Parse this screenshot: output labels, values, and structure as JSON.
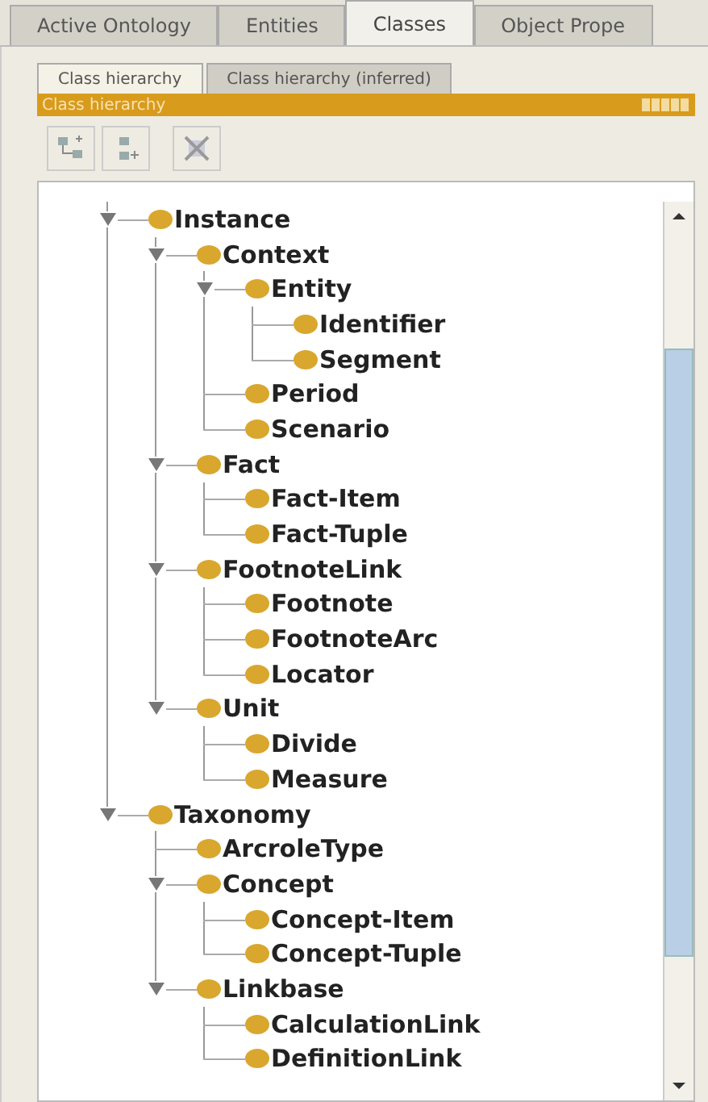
{
  "tabs": [
    {
      "label": "Active Ontology",
      "selected": false
    },
    {
      "label": "Entities",
      "selected": false
    },
    {
      "label": "Classes",
      "selected": true
    },
    {
      "label": "Object Prope",
      "selected": false
    }
  ],
  "subtabs": [
    {
      "label": "Class hierarchy",
      "selected": true
    },
    {
      "label": "Class hierarchy (inferred)",
      "selected": false
    }
  ],
  "panel": {
    "title": "Class hierarchy"
  },
  "toolbar": [
    {
      "kind": "add-subclass"
    },
    {
      "kind": "add-sibling"
    },
    {
      "kind": "delete"
    }
  ],
  "tree": [
    {
      "label": "Instance",
      "expanded": true,
      "children": [
        {
          "label": "Context",
          "expanded": true,
          "children": [
            {
              "label": "Entity",
              "expanded": true,
              "children": [
                {
                  "label": "Identifier"
                },
                {
                  "label": "Segment"
                }
              ]
            },
            {
              "label": "Period"
            },
            {
              "label": "Scenario"
            }
          ]
        },
        {
          "label": "Fact",
          "expanded": true,
          "children": [
            {
              "label": "Fact-Item"
            },
            {
              "label": "Fact-Tuple"
            }
          ]
        },
        {
          "label": "FootnoteLink",
          "expanded": true,
          "children": [
            {
              "label": "Footnote"
            },
            {
              "label": "FootnoteArc"
            },
            {
              "label": "Locator"
            }
          ]
        },
        {
          "label": "Unit",
          "expanded": true,
          "children": [
            {
              "label": "Divide"
            },
            {
              "label": "Measure"
            }
          ]
        }
      ]
    },
    {
      "label": "Taxonomy",
      "expanded": true,
      "children": [
        {
          "label": "ArcroleType"
        },
        {
          "label": "Concept",
          "expanded": true,
          "children": [
            {
              "label": "Concept-Item"
            },
            {
              "label": "Concept-Tuple"
            }
          ]
        },
        {
          "label": "Linkbase",
          "expanded": true,
          "children": [
            {
              "label": "CalculationLink"
            },
            {
              "label": "DefinitionLink"
            }
          ]
        }
      ]
    }
  ]
}
